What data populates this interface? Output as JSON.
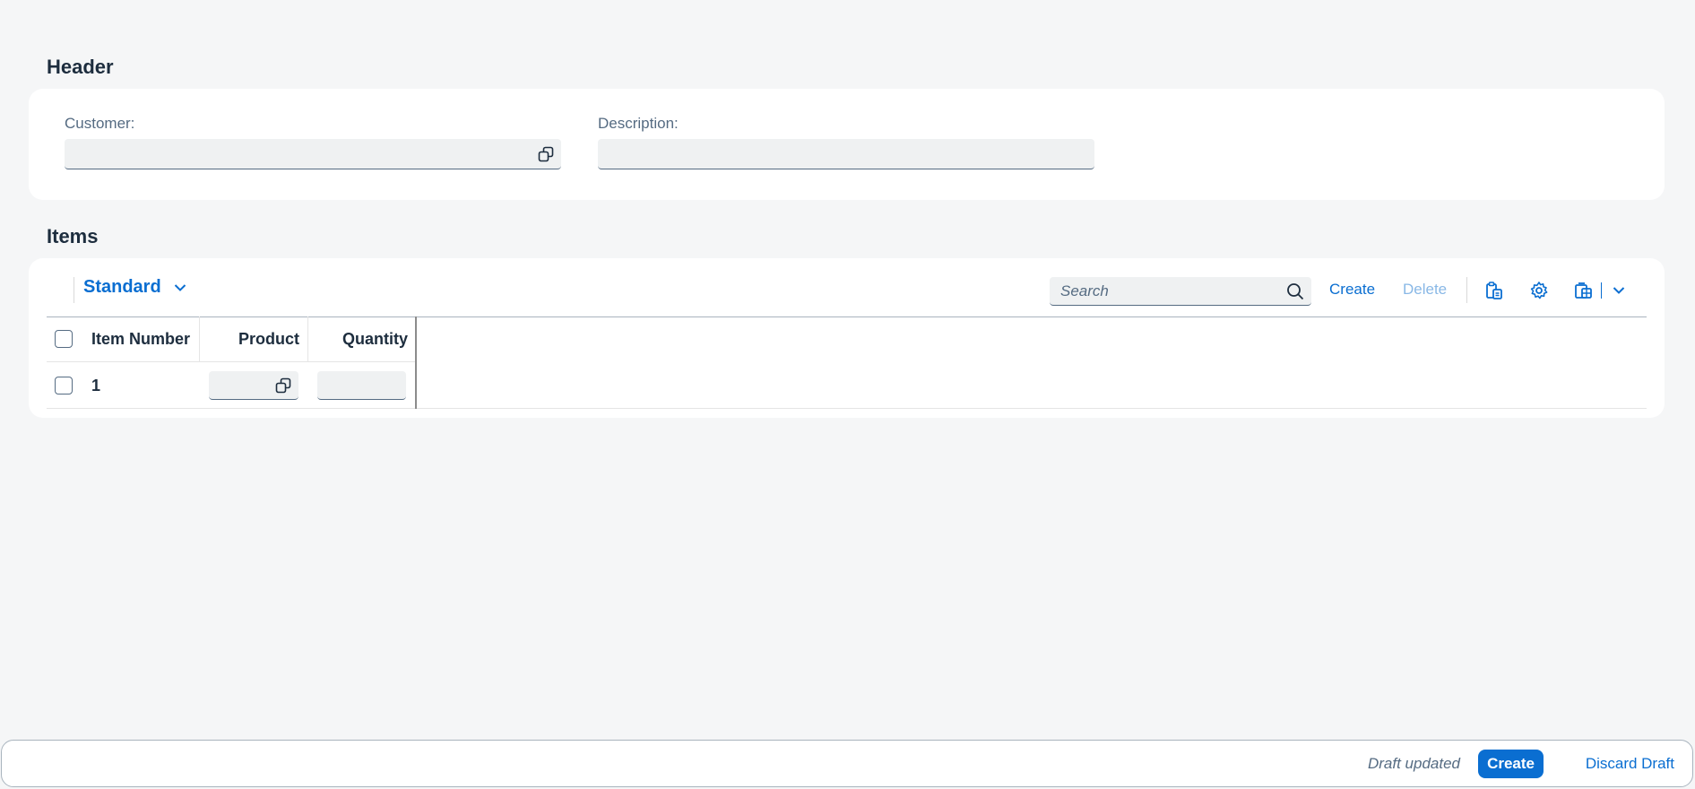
{
  "header_section": {
    "title": "Header",
    "customer_label": "Customer:",
    "customer_value": "",
    "description_label": "Description:",
    "description_value": ""
  },
  "items_section": {
    "title": "Items",
    "variant": "Standard",
    "search_placeholder": "Search",
    "create_label": "Create",
    "delete_label": "Delete",
    "columns": [
      "Item Number",
      "Product",
      "Quantity"
    ],
    "rows": [
      {
        "item_number": "1",
        "product": "",
        "quantity": ""
      }
    ]
  },
  "footer": {
    "status": "Draft updated",
    "create_label": "Create",
    "discard_label": "Discard Draft"
  },
  "colors": {
    "accent": "#0a6ed1",
    "background": "#f5f6f7",
    "card": "#ffffff",
    "text": "#1d2d3e"
  }
}
